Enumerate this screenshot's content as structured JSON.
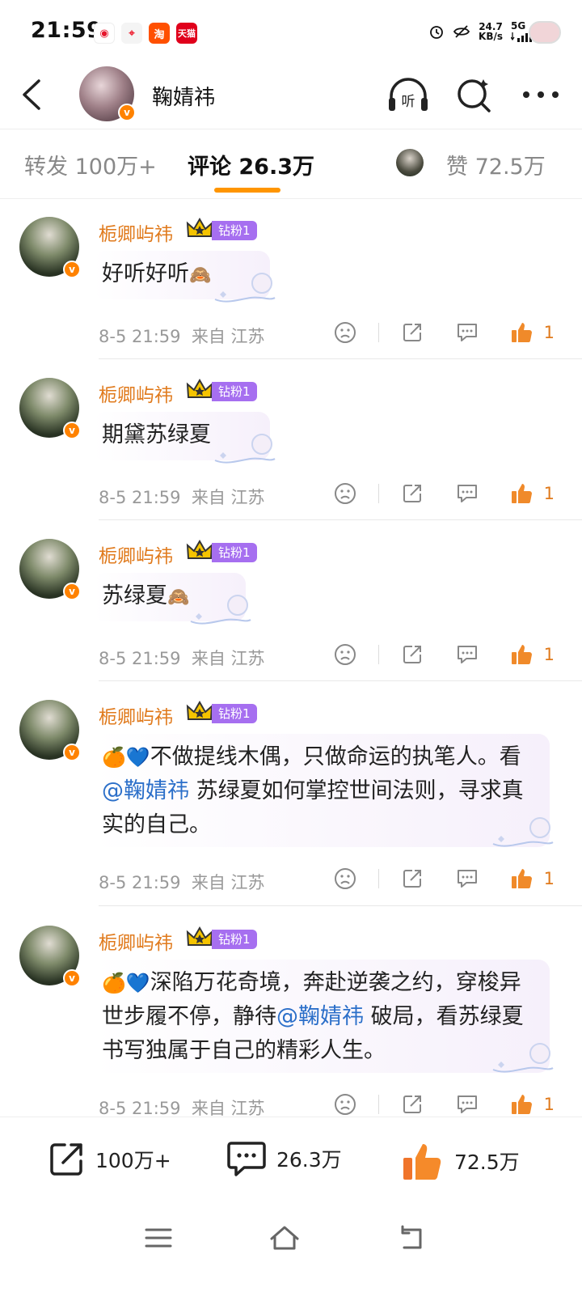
{
  "status_bar": {
    "time": "21:59",
    "apps": [
      {
        "icon": "weibo-icon",
        "color": "#e6162d",
        "glyph": "◉"
      },
      {
        "icon": "map-icon",
        "color": "#f0f0f0",
        "glyph": "📍"
      },
      {
        "icon": "taobao-icon",
        "color": "#ff5000",
        "glyph": "淘"
      },
      {
        "icon": "tmall-icon",
        "color": "#e0001b",
        "glyph": "天猫"
      }
    ],
    "net_speed_value": "24.7",
    "net_speed_unit": "KB/s",
    "network": "5G"
  },
  "header": {
    "user_name": "鞠婧祎"
  },
  "tabs": {
    "repost": "转发 100万+",
    "comment": "评论 26.3万",
    "like": "赞 72.5万"
  },
  "comments": [
    {
      "author": "栀卿屿祎",
      "badge": "钻粉1",
      "text": "好听好听",
      "emoji": "🙈",
      "time": "8-5 21:59",
      "location": "来自 江苏",
      "likes": "1"
    },
    {
      "author": "栀卿屿祎",
      "badge": "钻粉1",
      "text": "期黛苏绿夏",
      "emoji": "",
      "time": "8-5 21:59",
      "location": "来自 江苏",
      "likes": "1"
    },
    {
      "author": "栀卿屿祎",
      "badge": "钻粉1",
      "text": "苏绿夏",
      "emoji": "🙈",
      "time": "8-5 21:59",
      "location": "来自 江苏",
      "likes": "1"
    },
    {
      "author": "栀卿屿祎",
      "badge": "钻粉1",
      "emoji_prefix": "🍊💙",
      "text_before": "不做提线木偶，只做命运的执笔人。看",
      "mention": "@鞠婧祎",
      "text_after": " 苏绿夏如何掌控世间法则，寻求真实的自己。",
      "time": "8-5 21:59",
      "location": "来自 江苏",
      "likes": "1"
    },
    {
      "author": "栀卿屿祎",
      "badge": "钻粉1",
      "emoji_prefix": "🍊💙",
      "text_before": "深陷万花奇境，奔赴逆袭之约，穿梭异世步履不停，静待",
      "mention": "@鞠婧祎",
      "text_after": " 破局，看苏绿夏书写独属于自己的精彩人生。",
      "time": "8-5 21:59",
      "location": "来自 江苏",
      "likes": "1"
    }
  ],
  "bottom_bar": {
    "repost_count": "100万+",
    "comment_count": "26.3万",
    "like_count": "72.5万"
  },
  "colors": {
    "accent_orange": "#ff9500",
    "name_orange": "#e07a1c",
    "mention_blue": "#2b6fc9",
    "fan_badge_purple": "#a66ff0"
  }
}
